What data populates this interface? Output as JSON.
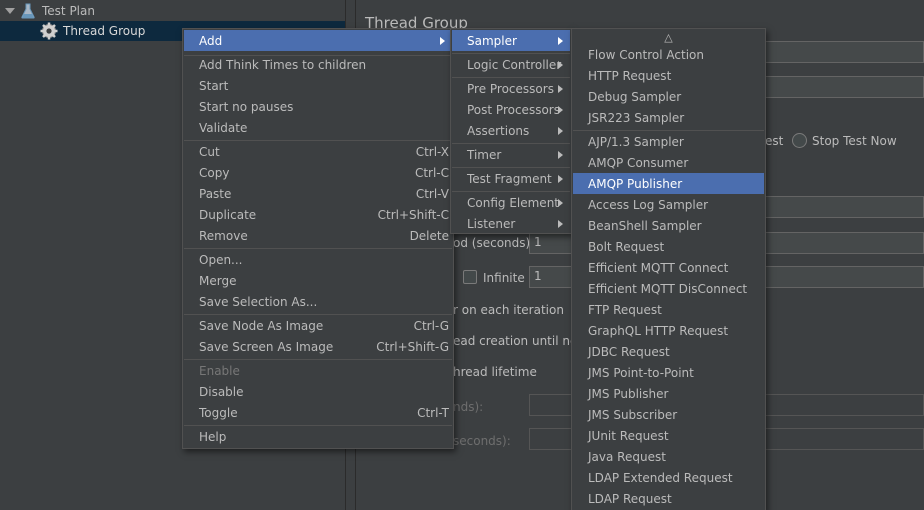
{
  "tree": {
    "test_plan": "Test Plan",
    "thread_group": "Thread Group"
  },
  "panel": {
    "title": "Thread Group",
    "stop_test_partial": "est",
    "stop_test_now": "Stop Test Now",
    "ramp_label_partial": "od (seconds):",
    "ramp_value": "1",
    "infinite_label": "Infinite",
    "loop_value": "1",
    "same_user_partial": "r on each iteration",
    "delay_partial": "ead creation until need",
    "lifetime_partial": "hread lifetime",
    "duration_partial": "nds):",
    "startup_partial": "seconds):"
  },
  "context_menu": {
    "add": "Add",
    "add_think_times": "Add Think Times to children",
    "start": "Start",
    "start_no_pauses": "Start no pauses",
    "validate": "Validate",
    "cut": "Cut",
    "cut_sc": "Ctrl-X",
    "copy": "Copy",
    "copy_sc": "Ctrl-C",
    "paste": "Paste",
    "paste_sc": "Ctrl-V",
    "duplicate": "Duplicate",
    "duplicate_sc": "Ctrl+Shift-C",
    "remove": "Remove",
    "remove_sc": "Delete",
    "open": "Open...",
    "merge": "Merge",
    "save_selection": "Save Selection As...",
    "save_node_image": "Save Node As Image",
    "save_node_image_sc": "Ctrl-G",
    "save_screen_image": "Save Screen As Image",
    "save_screen_image_sc": "Ctrl+Shift-G",
    "enable": "Enable",
    "disable": "Disable",
    "toggle": "Toggle",
    "toggle_sc": "Ctrl-T",
    "help": "Help"
  },
  "add_menu": {
    "sampler": "Sampler",
    "logic_controller": "Logic Controller",
    "pre_processors": "Pre Processors",
    "post_processors": "Post Processors",
    "assertions": "Assertions",
    "timer": "Timer",
    "test_fragment": "Test Fragment",
    "config_element": "Config Element",
    "listener": "Listener"
  },
  "sampler_menu": {
    "scroll_up": "△",
    "items": [
      "Flow Control Action",
      "HTTP Request",
      "Debug Sampler",
      "JSR223 Sampler",
      "AJP/1.3 Sampler",
      "AMQP Consumer",
      "AMQP Publisher",
      "Access Log Sampler",
      "BeanShell Sampler",
      "Bolt Request",
      "Efficient MQTT Connect",
      "Efficient MQTT DisConnect",
      "FTP Request",
      "GraphQL HTTP Request",
      "JDBC Request",
      "JMS Point-to-Point",
      "JMS Publisher",
      "JMS Subscriber",
      "JUnit Request",
      "Java Request",
      "LDAP Extended Request",
      "LDAP Request"
    ]
  },
  "colors": {
    "background": "#3c3f41",
    "highlight": "#4b6eaf",
    "tree_selection": "#0d293e",
    "text": "#bbbbbb"
  }
}
